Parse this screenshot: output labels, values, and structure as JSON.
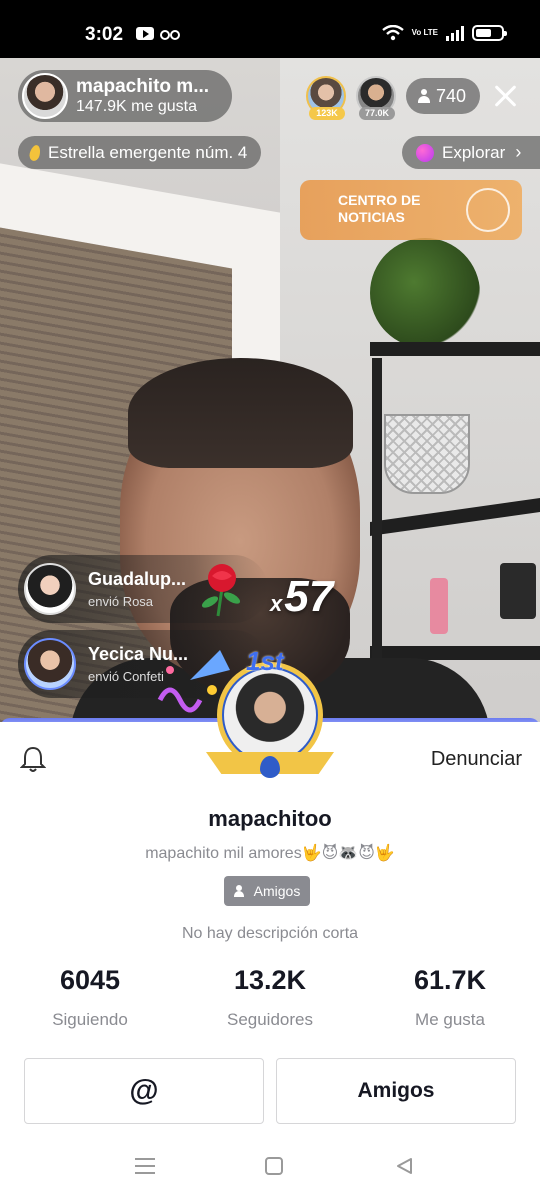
{
  "status_bar": {
    "time": "3:02",
    "volte": "Vo LTE"
  },
  "live": {
    "host": {
      "name": "mapachito m...",
      "likes": "147.9K me gusta"
    },
    "top_viewers": [
      {
        "score": "123K"
      },
      {
        "score": "77.0K"
      }
    ],
    "viewer_count": "740",
    "star_label": "Estrella emergente núm. 4",
    "explore_label": "Explorar",
    "news_banner": {
      "line1": "CENTRO DE",
      "line2": "NOTICIAS"
    },
    "gifts": [
      {
        "name": "Guadalup...",
        "action": "envió Rosa"
      },
      {
        "name": "Yecica Nu...",
        "action": "envió Confeti"
      }
    ],
    "combo": {
      "prefix": "x",
      "count": "57"
    },
    "rank_badge": "1st"
  },
  "profile": {
    "report_label": "Denunciar",
    "username": "mapachitoo",
    "bio": "mapachito mil amores🤟😈🦝😈🤟",
    "tag": "Amigos",
    "description": "No hay descripción corta",
    "stats": [
      {
        "value": "6045",
        "label": "Siguiendo"
      },
      {
        "value": "13.2K",
        "label": "Seguidores"
      },
      {
        "value": "61.7K",
        "label": "Me gusta"
      }
    ],
    "mention_button": "@",
    "friends_button": "Amigos"
  },
  "colors": {
    "accent_blue": "#3e6ef0",
    "gold": "#f2c546",
    "muted_text": "#8a8b91"
  }
}
